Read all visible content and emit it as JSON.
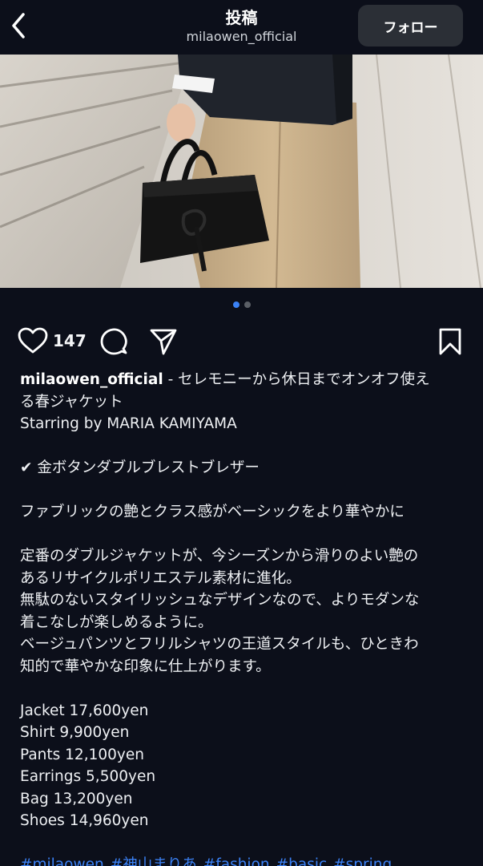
{
  "header": {
    "title": "投稿",
    "username": "milaowen_official",
    "follow_label": "フォロー"
  },
  "carousel": {
    "total": 2,
    "current": 1
  },
  "actions": {
    "like_count": "147"
  },
  "caption": {
    "username": "milaowen_official",
    "lead_text": " - セレモニーから休日までオンオフ使え",
    "lines": [
      "る春ジャケット",
      "Starring by MARIA KAMIYAMA",
      "",
      "✔ 金ボタンダブルブレストブレザー",
      "",
      "ファブリックの艶とクラス感がベーシックをより華やかに",
      "",
      "定番のダブルジャケットが、今シーズンから滑りのよい艶の",
      "あるリサイクルポリエステル素材に進化。",
      "無駄のないスタイリッシュなデザインなので、よりモダンな",
      "着こなしが楽しめるように。",
      "ベージュパンツとフリルシャツの王道スタイルも、ひときわ",
      "知的で華やかな印象に仕上がります。",
      "",
      "Jacket 17,600yen",
      "Shirt 9,900yen",
      "Pants 12,100yen",
      "Earrings 5,500yen",
      "Bag 13,200yen",
      "Shoes 14,960yen",
      ""
    ],
    "hashtags": [
      "#milaowen",
      "#神山まりあ",
      "#fashion",
      "#basic",
      "#spring"
    ]
  },
  "colors": {
    "background": "#0c0f1a",
    "link": "#3b82f6",
    "button_bg": "#2b2f36"
  },
  "icons": [
    "chevron-left-icon",
    "heart-icon",
    "comment-icon",
    "share-icon",
    "bookmark-icon"
  ]
}
